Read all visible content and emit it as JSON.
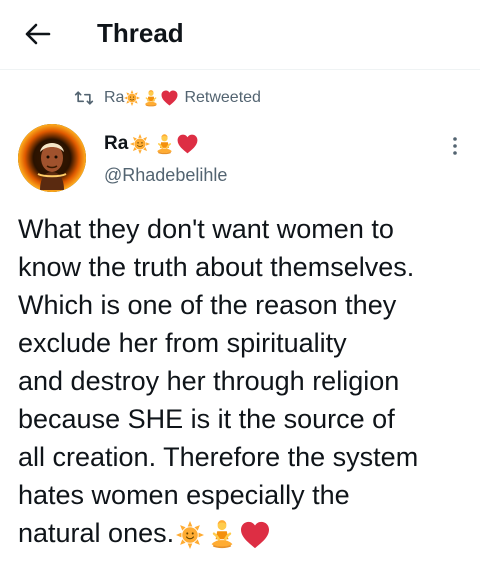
{
  "header": {
    "title": "Thread",
    "back_icon": "arrow-left-icon"
  },
  "retweet": {
    "icon": "retweet-icon",
    "name": "Ra",
    "suffix": "Retweeted",
    "emojis": [
      "sun-emoji",
      "person-lotus-emoji",
      "red-heart-emoji"
    ]
  },
  "tweet": {
    "author_name": "Ra",
    "author_emojis": [
      "sun-emoji",
      "person-lotus-emoji",
      "red-heart-emoji"
    ],
    "handle": "@Rhadebelihle",
    "more_icon": "more-vertical-icon",
    "text": "What they don't want women to know the truth about themselves. Which is one of the reason they exclude her from spirituality and destroy her through religion because SHE is it the source of all creation. Therefore the system hates women especially the natural ones.",
    "text_lines": [
      "What they don't want women to",
      "know the truth about themselves.",
      "Which is one of the reason they",
      "exclude her from spirituality",
      "and destroy her through religion",
      "because SHE is it the source of",
      "all creation. Therefore the system",
      "hates women especially the",
      "natural ones."
    ],
    "trailing_emojis": [
      "sun-emoji",
      "person-lotus-emoji",
      "red-heart-emoji"
    ]
  },
  "colors": {
    "text_primary": "#0f1419",
    "text_secondary": "#536471",
    "divider": "#eff3f4",
    "heart": "#e0245e",
    "sun": "#ffac33"
  }
}
